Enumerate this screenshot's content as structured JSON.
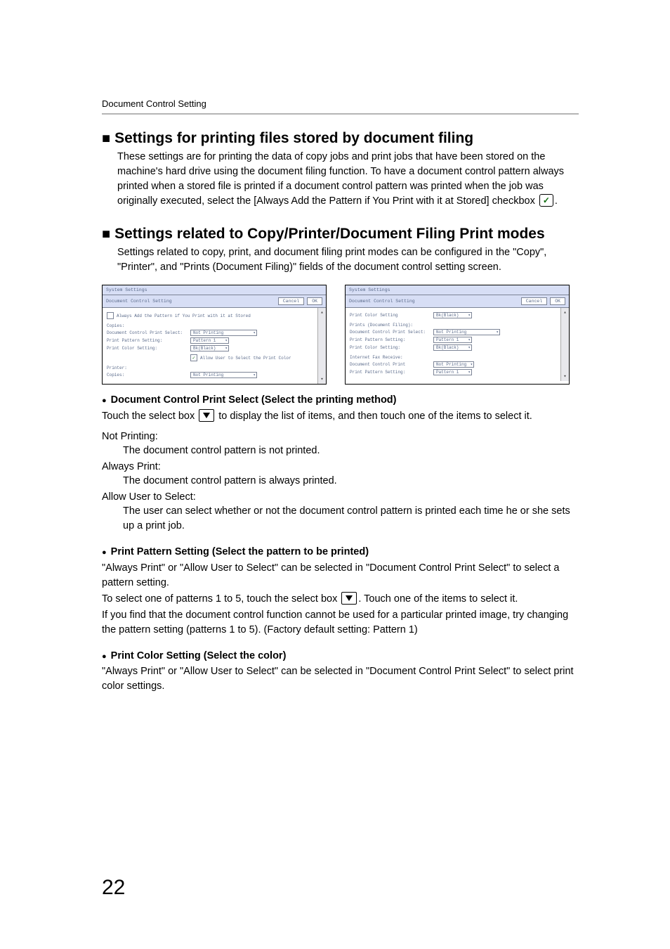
{
  "header": {
    "title": "Document Control Setting"
  },
  "section1": {
    "title": "Settings for printing files stored by document filing",
    "body": "These settings are for printing the data of copy jobs and print jobs that have been stored on the machine's hard drive using the document filing function. To have a document control pattern always printed when a stored file is printed if a document control pattern was printed when the job was originally executed, select the [Always Add the Pattern if You Print with it at Stored] checkbox",
    "body_after_icon": "."
  },
  "section2": {
    "title": "Settings related to Copy/Printer/Document Filing Print modes",
    "body": "Settings related to copy, print, and document filing print modes can be configured in the \"Copy\", \"Printer\", and \"Prints (Document Filing)\" fields of the document control setting screen."
  },
  "mock_left": {
    "titlebar": "System Settings",
    "subtitle": "Document Control Setting",
    "btn_cancel": "Cancel",
    "btn_ok": "OK",
    "check_label": "Always Add the Pattern if You Print with it at Stored",
    "grp_copies": "Copies:",
    "row_dcps": "Document Control Print Select:",
    "val_notprinting": "Not Printing",
    "row_pps": "Print Pattern Setting:",
    "val_pattern1": "Pattern 1",
    "row_pcs": "Print Color Setting:",
    "val_bk": "Bk(Black)",
    "allow_label": "Allow User to Select the Print Color",
    "grp_printer": "Printer:",
    "row_copies2": "Copies:"
  },
  "mock_right": {
    "titlebar": "System Settings",
    "subtitle": "Document Control Setting",
    "btn_cancel": "Cancel",
    "btn_ok": "OK",
    "row_pcs": "Print Color Setting",
    "val_bk": "Bk(Black)",
    "grp_prints": "Prints (Document Filing):",
    "row_dcps": "Document Control Print Select:",
    "val_notprinting": "Not Printing",
    "row_pps": "Print Pattern Setting:",
    "val_pattern1": "Pattern 1",
    "row_pcs2": "Print Color Setting:",
    "grp_ifax": "Internet Fax Receive:",
    "row_dcp": "Document Control Print",
    "row_pps2": "Print Pattern Setting:"
  },
  "sub1": {
    "heading": "Document Control Print Select (Select the printing method)",
    "intro_a": "Touch the select box",
    "intro_b": " to display the list of items, and then touch one of the items to select it.",
    "term1": "Not Printing:",
    "body1": "The document control pattern is not printed.",
    "term2": "Always Print:",
    "body2": "The document control pattern is always printed.",
    "term3": "Allow User to Select:",
    "body3": "The user can select whether or not the document control pattern is printed each time he or she sets up a print job."
  },
  "sub2": {
    "heading": "Print Pattern Setting (Select the pattern to be printed)",
    "p1": "\"Always Print\" or \"Allow User to Select\" can be selected in \"Document Control Print Select\" to select a pattern setting.",
    "p2a": "To select one of patterns 1 to 5, touch the select box",
    "p2b": ". Touch one of the items to select it.",
    "p3": "If you find that the document control function cannot be used for a particular printed image, try changing the pattern setting (patterns 1 to 5). (Factory default setting: Pattern 1)"
  },
  "sub3": {
    "heading": "Print Color Setting (Select the color)",
    "p1": "\"Always Print\" or \"Allow User to Select\" can be selected in \"Document Control Print Select\" to select print color settings."
  },
  "page_number": "22"
}
